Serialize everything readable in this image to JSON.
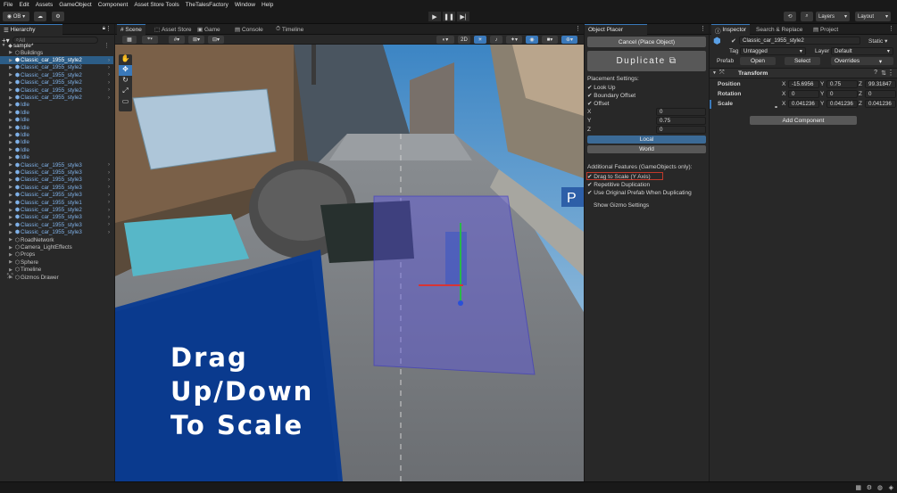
{
  "menu": [
    "File",
    "Edit",
    "Assets",
    "GameObject",
    "Component",
    "Asset Store Tools",
    "TheTalesFactory",
    "Window",
    "Help"
  ],
  "toolbar": {
    "account": "OB",
    "layers": "Layers",
    "layout": "Layout"
  },
  "hierarchy": {
    "tab": "Hierarchy",
    "search_placeholder": "All",
    "scene": "sample*",
    "rows": [
      {
        "label": "Buildings",
        "style": "gray",
        "indent": 1,
        "chevron": false
      },
      {
        "label": "Classic_car_1955_style2",
        "style": "sel",
        "indent": 1,
        "chevron": true
      },
      {
        "label": "Classic_car_1955_style2",
        "style": "blue",
        "indent": 1,
        "chevron": true
      },
      {
        "label": "Classic_car_1955_style2",
        "style": "blue",
        "indent": 1,
        "chevron": true
      },
      {
        "label": "Classic_car_1955_style2",
        "style": "blue",
        "indent": 1,
        "chevron": true
      },
      {
        "label": "Classic_car_1955_style2",
        "style": "blue",
        "indent": 1,
        "chevron": true
      },
      {
        "label": "Classic_car_1955_style2",
        "style": "blue",
        "indent": 1,
        "chevron": true
      },
      {
        "label": "Idle",
        "style": "blue",
        "indent": 1,
        "chevron": false
      },
      {
        "label": "Idle",
        "style": "blue",
        "indent": 1,
        "chevron": false
      },
      {
        "label": "Idle",
        "style": "blue",
        "indent": 1,
        "chevron": false
      },
      {
        "label": "Idle",
        "style": "blue",
        "indent": 1,
        "chevron": false
      },
      {
        "label": "Idle",
        "style": "blue",
        "indent": 1,
        "chevron": false
      },
      {
        "label": "Idle",
        "style": "blue",
        "indent": 1,
        "chevron": false
      },
      {
        "label": "Idle",
        "style": "blue",
        "indent": 1,
        "chevron": false
      },
      {
        "label": "Idle",
        "style": "blue",
        "indent": 1,
        "chevron": false
      },
      {
        "label": "Classic_car_1955_style3",
        "style": "blue",
        "indent": 1,
        "chevron": true
      },
      {
        "label": "Classic_car_1955_style3",
        "style": "blue",
        "indent": 1,
        "chevron": true
      },
      {
        "label": "Classic_car_1955_style3",
        "style": "blue",
        "indent": 1,
        "chevron": true
      },
      {
        "label": "Classic_car_1955_style3",
        "style": "blue",
        "indent": 1,
        "chevron": true
      },
      {
        "label": "Classic_car_1955_style3",
        "style": "blue",
        "indent": 1,
        "chevron": true
      },
      {
        "label": "Classic_car_1955_style1",
        "style": "blue",
        "indent": 1,
        "chevron": true
      },
      {
        "label": "Classic_car_1955_style2",
        "style": "blue",
        "indent": 1,
        "chevron": true
      },
      {
        "label": "Classic_car_1955_style3",
        "style": "blue",
        "indent": 1,
        "chevron": true
      },
      {
        "label": "Classic_car_1955_style3",
        "style": "blue",
        "indent": 1,
        "chevron": true
      },
      {
        "label": "Classic_car_1955_style3",
        "style": "blue",
        "indent": 1,
        "chevron": true
      },
      {
        "label": "RoadNetwork",
        "style": "gray",
        "indent": 1,
        "chevron": false
      },
      {
        "label": "Camera_LightEffects",
        "style": "gray",
        "indent": 1,
        "chevron": false
      },
      {
        "label": "Props",
        "style": "gray",
        "indent": 1,
        "chevron": false
      },
      {
        "label": "Sphere",
        "style": "gray",
        "indent": 1,
        "chevron": false
      },
      {
        "label": "Timeline",
        "style": "gray",
        "indent": 1,
        "chevron": false
      },
      {
        "label": "Gizmos Drawer",
        "style": "gray",
        "indent": 1,
        "chevron": false
      }
    ]
  },
  "scene_tabs": [
    "Scene",
    "Asset Store",
    "Game",
    "Console",
    "Timeline"
  ],
  "scene": {
    "mode_2d": "2D",
    "caption_line1": "Drag Up/Down",
    "caption_line2": "To Scale",
    "sign": "P"
  },
  "placer": {
    "tab": "Object Placer",
    "cancel": "Cancel (Place Object)",
    "duplicate": "Duplicate",
    "settings_title": "Placement Settings:",
    "checks": [
      "Look Up",
      "Boundary Offset",
      "Offset"
    ],
    "x_label": "X",
    "x_value": "0",
    "y_label": "Y",
    "y_value": "0.75",
    "z_label": "Z",
    "z_value": "0",
    "local": "Local",
    "world": "World",
    "additional_title": "Additional Features (GameObjects only):",
    "features": [
      "Drag to Scale (Y Axis)",
      "Repetitive Duplication",
      "Use Original Prefab When Duplicating"
    ],
    "gizmo": "Show Gizmo Settings"
  },
  "inspector": {
    "tabs": [
      "Inspector",
      "Search & Replace",
      "Project"
    ],
    "object_name": "Classic_car_1955_style2",
    "static": "Static",
    "tag_label": "Tag",
    "tag_value": "Untagged",
    "layer_label": "Layer",
    "layer_value": "Default",
    "prefab_label": "Prefab",
    "open": "Open",
    "select": "Select",
    "overrides": "Overrides",
    "transform": "Transform",
    "position_label": "Position",
    "rotation_label": "Rotation",
    "scale_label": "Scale",
    "position": [
      "-15.6956",
      "0.75",
      "99.31847"
    ],
    "rotation": [
      "0",
      "0",
      "0"
    ],
    "scale": [
      "0.041236",
      "0.041236",
      "0.041236"
    ],
    "axis": [
      "X",
      "Y",
      "Z"
    ],
    "add_component": "Add Component"
  },
  "colors": {
    "accent": "#3a79bb",
    "caption_bg": "#0d3d91",
    "selection": "#2c5d87",
    "bg": "#282828"
  }
}
